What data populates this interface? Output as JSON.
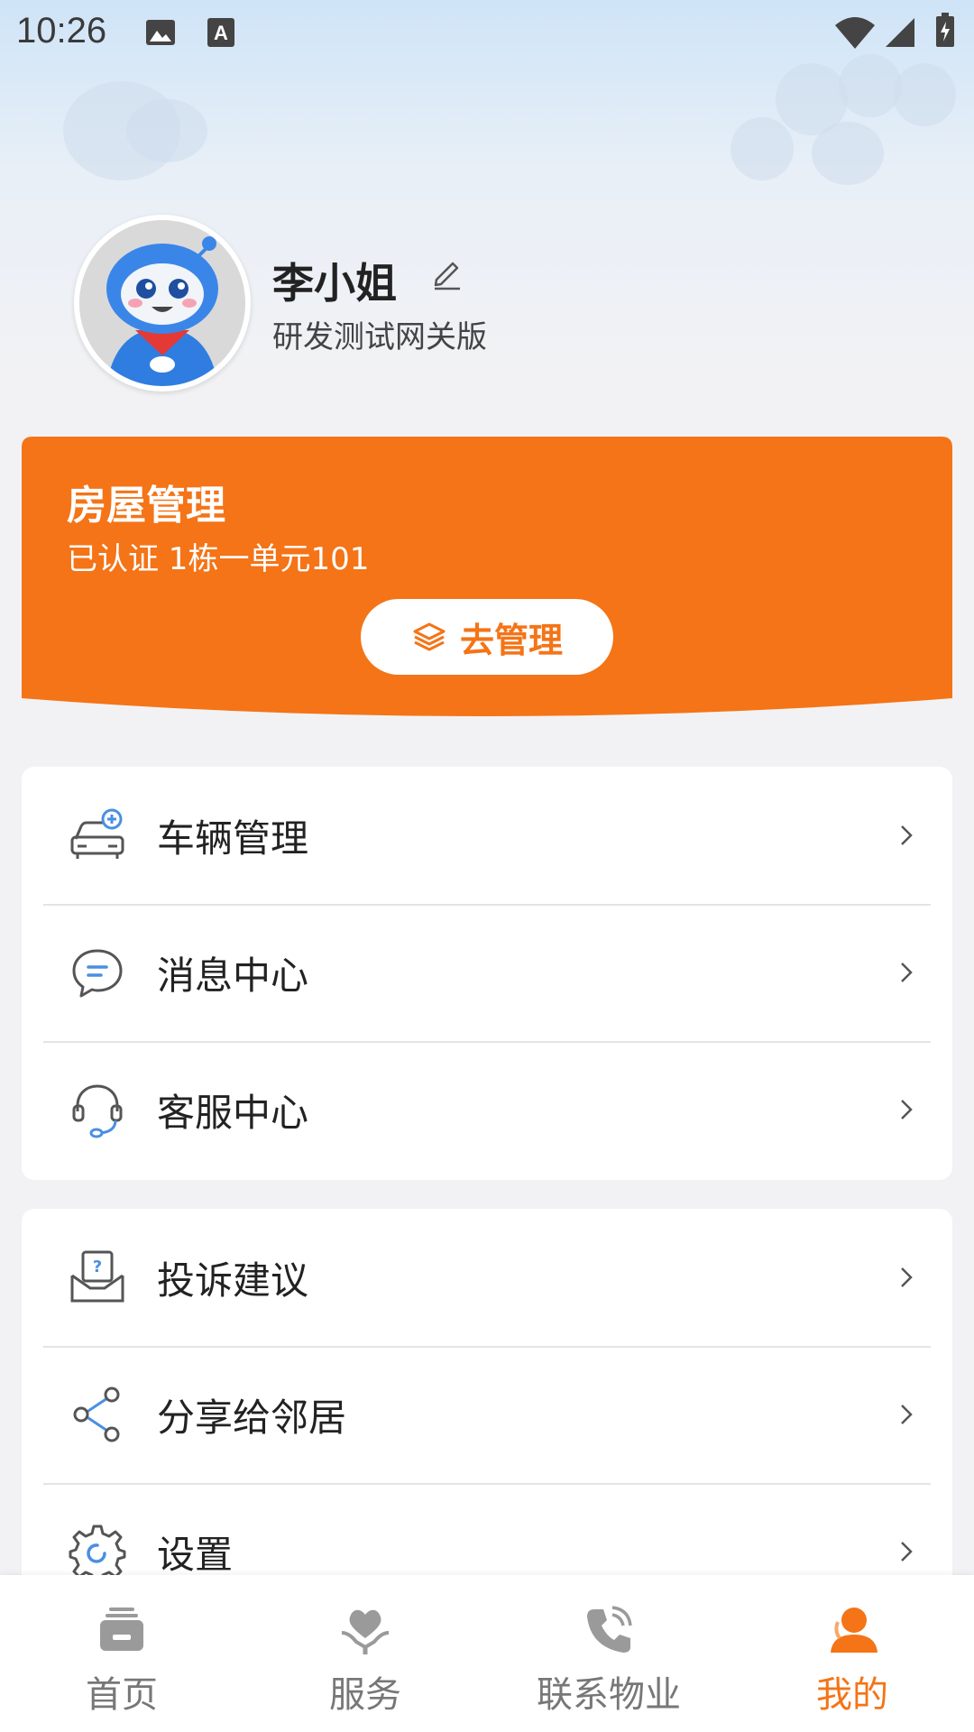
{
  "status_bar": {
    "time": "10:26"
  },
  "profile": {
    "name": "李小姐",
    "subtitle": "研发测试网关版"
  },
  "house_card": {
    "title": "房屋管理",
    "subtitle": "已认证 1栋一单元101",
    "button_label": "去管理"
  },
  "menu_groups": [
    {
      "items": [
        {
          "label": "车辆管理",
          "icon": "car-icon"
        },
        {
          "label": "消息中心",
          "icon": "message-icon"
        },
        {
          "label": "客服中心",
          "icon": "headset-icon"
        }
      ]
    },
    {
      "items": [
        {
          "label": "投诉建议",
          "icon": "complaint-icon"
        },
        {
          "label": "分享给邻居",
          "icon": "share-icon"
        },
        {
          "label": "设置",
          "icon": "settings-icon"
        }
      ]
    }
  ],
  "bottom_nav": {
    "items": [
      {
        "label": "首页",
        "icon": "home-icon"
      },
      {
        "label": "服务",
        "icon": "service-icon"
      },
      {
        "label": "联系物业",
        "icon": "phone-icon"
      },
      {
        "label": "我的",
        "icon": "user-icon"
      }
    ],
    "active": "我的"
  },
  "colors": {
    "accent": "#f47417",
    "icon_blue": "#4a8fe2",
    "icon_gray": "#555555"
  }
}
